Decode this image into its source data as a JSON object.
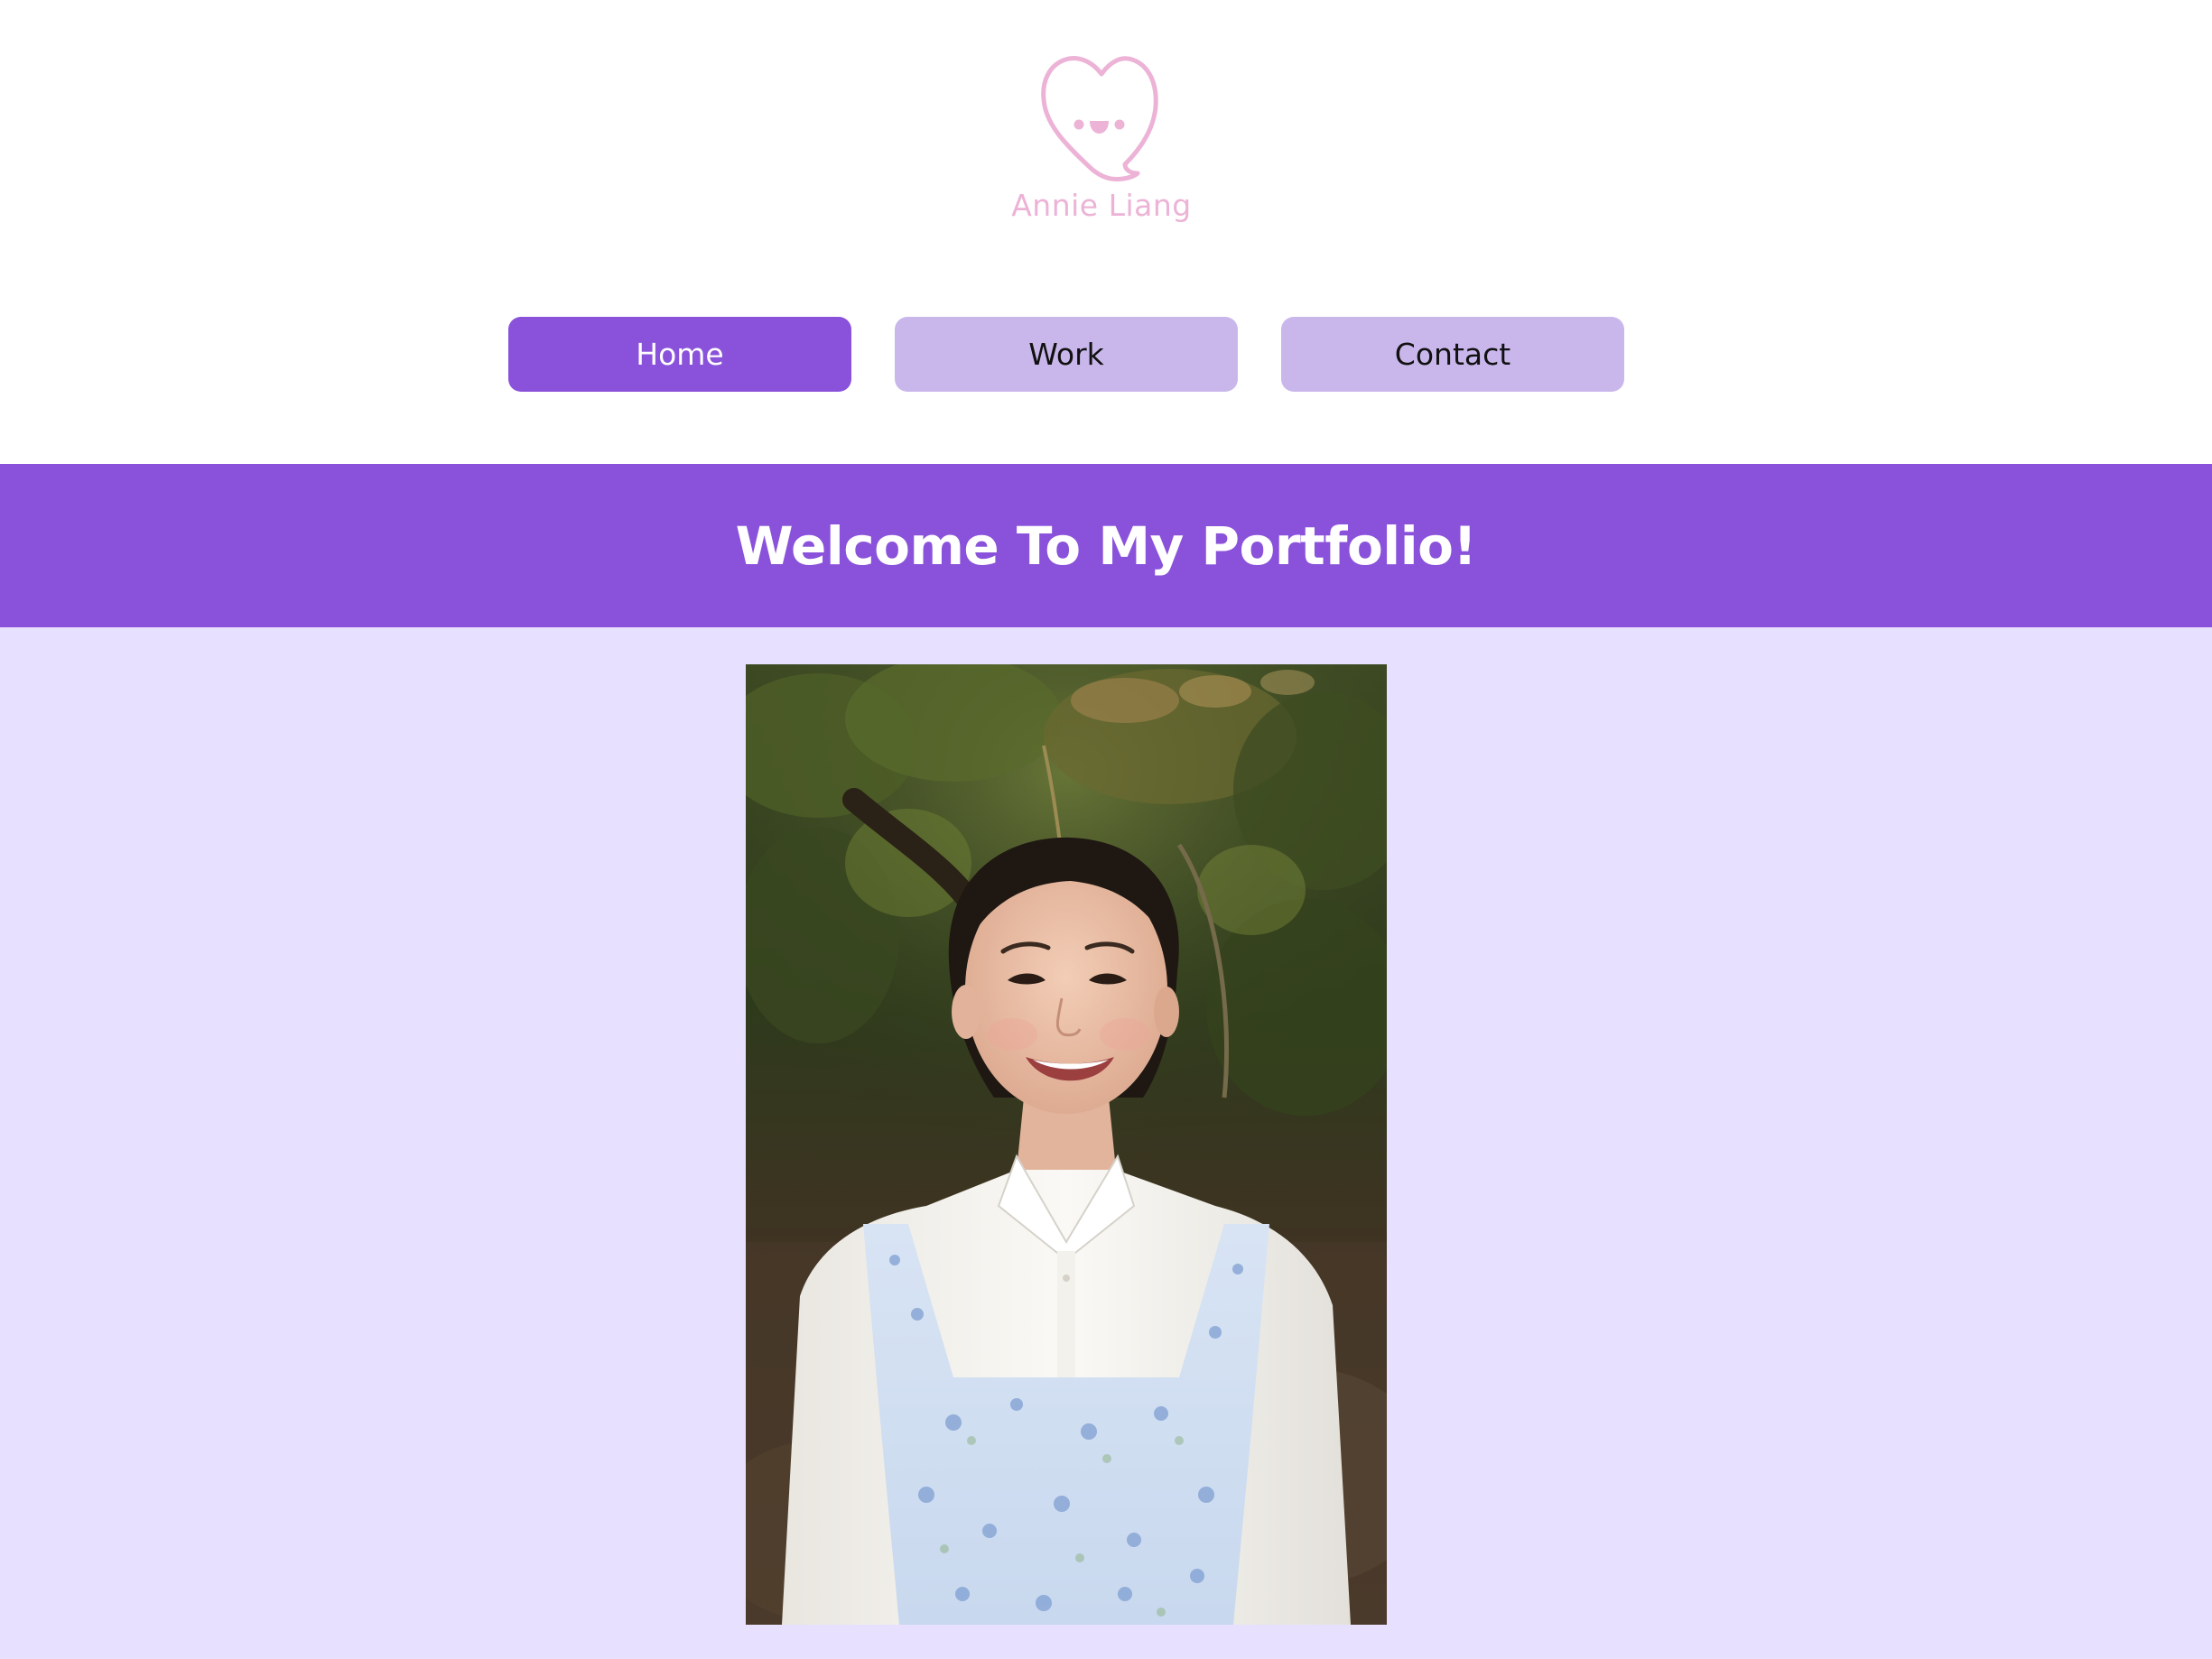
{
  "logo": {
    "icon": "heart-speech-bubble-face-icon",
    "text": "Annie Liang",
    "color": "#ecb3d6"
  },
  "nav": {
    "items": [
      {
        "label": "Home",
        "active": true
      },
      {
        "label": "Work",
        "active": false
      },
      {
        "label": "Contact",
        "active": false
      }
    ],
    "active_color": "#8a52da",
    "inactive_color": "#c9b7ec"
  },
  "banner": {
    "title": "Welcome To My Portfolio!",
    "color": "#8a52da"
  },
  "photo": {
    "icon": "portrait-photo"
  },
  "colors": {
    "page_background": "#e8e0ff",
    "header_background": "#ffffff"
  }
}
